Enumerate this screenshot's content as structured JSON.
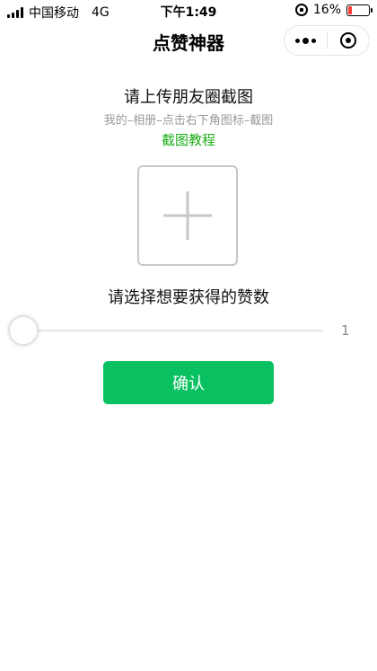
{
  "status_bar": {
    "carrier": "中国移动",
    "network": "4G",
    "time": "下午1:49",
    "battery_percent": "16%",
    "battery_level": 0.16
  },
  "nav": {
    "title": "点赞神器"
  },
  "content": {
    "heading": "请上传朋友圈截图",
    "instructions": "我的–相册–点击右下角图标–截图",
    "tutorial_link": "截图教程",
    "select_label": "请选择想要获得的赞数",
    "slider_value": "1",
    "confirm_label": "确认"
  },
  "colors": {
    "accent_green": "#09c160",
    "link_green": "#1aad19",
    "battery_red": "#ff3b30"
  },
  "icons": [
    "signal-icon",
    "orientation-lock-icon",
    "battery-icon",
    "more-icon",
    "close-icon",
    "plus-icon"
  ]
}
